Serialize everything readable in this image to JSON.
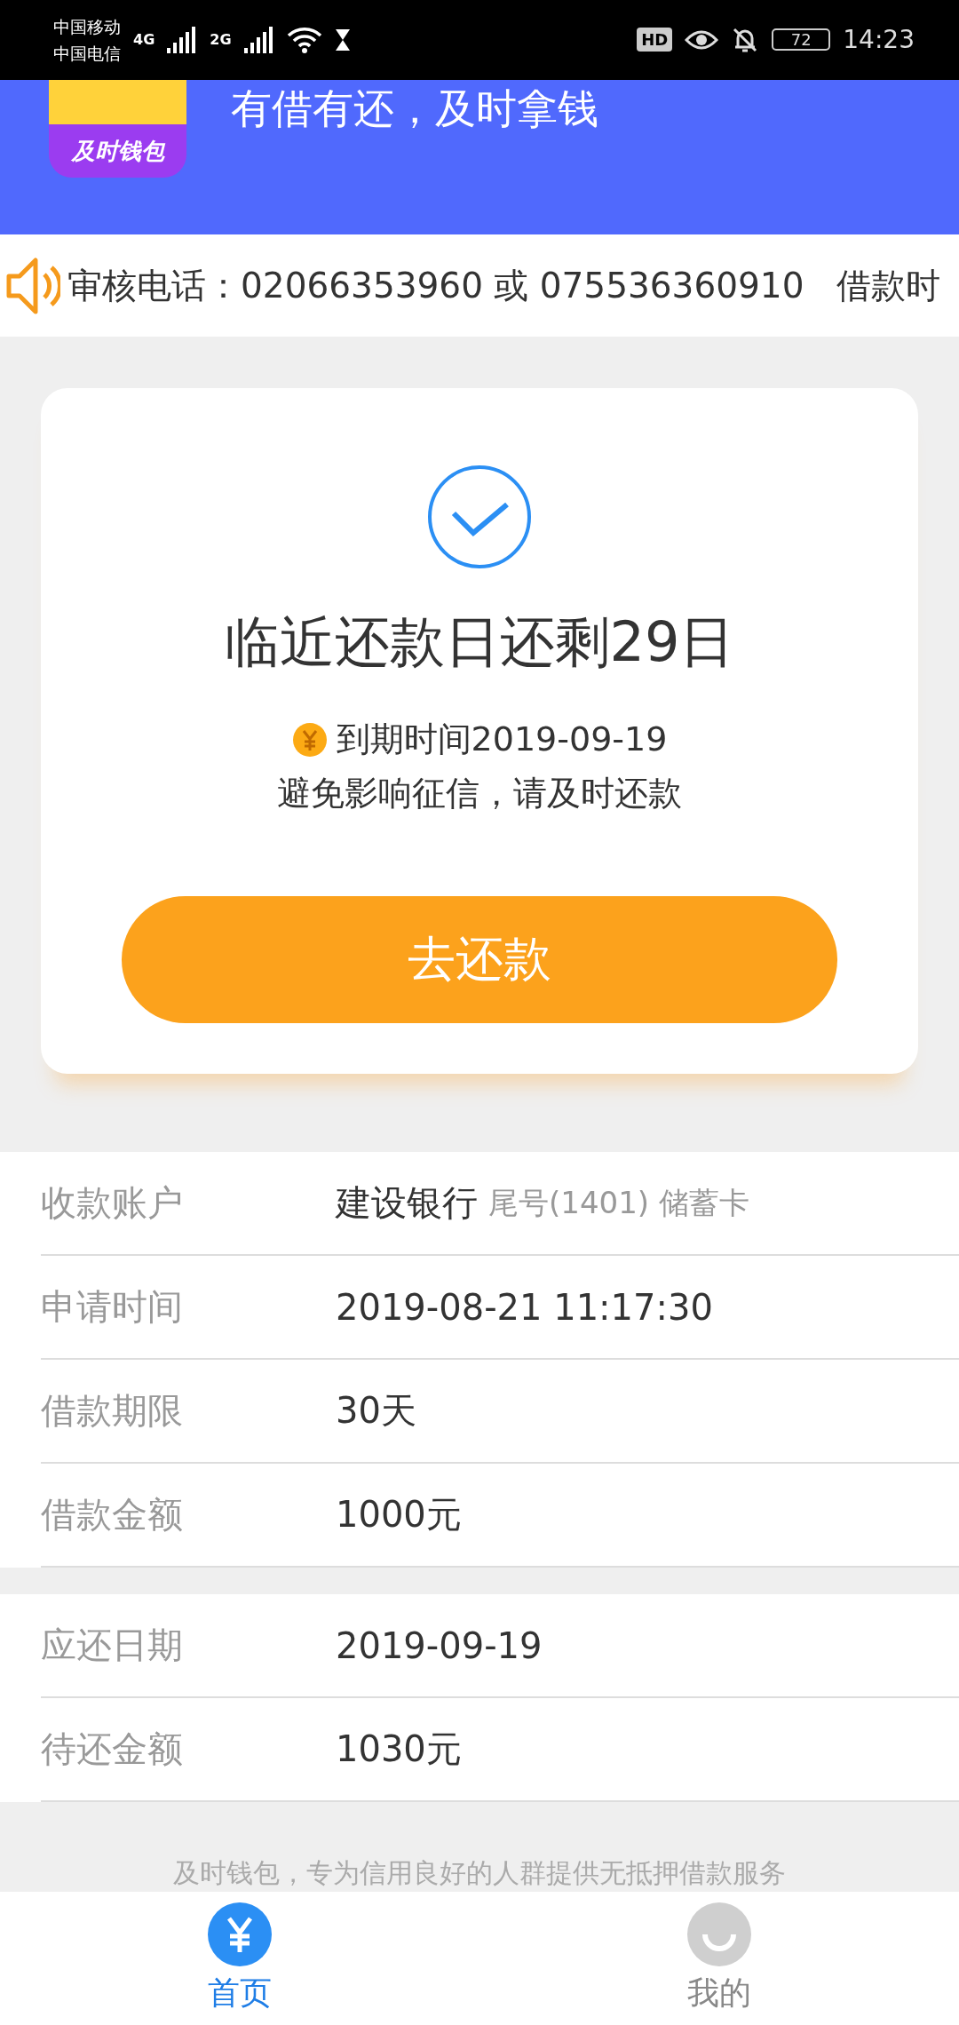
{
  "status_bar": {
    "carriers": [
      "中国移动",
      "中国电信"
    ],
    "networks": [
      "4G",
      "2G"
    ],
    "hd": "HD",
    "battery": "72",
    "time": "14:23"
  },
  "header": {
    "logo_text": "及时钱包",
    "slogan": "有借有还，及时拿钱"
  },
  "notice": {
    "items": [
      "审核电话：02066353960 或 075536360910",
      "借款时"
    ]
  },
  "repay_card": {
    "title": "临近还款日还剩29日",
    "due": "到期时间2019-09-19",
    "hint": "避免影响征信，请及时还款",
    "button": "去还款"
  },
  "loan_details": [
    {
      "label": "收款账户",
      "value": "建设银行",
      "note": "尾号(1401) 储蓄卡"
    },
    {
      "label": "申请时间",
      "value": "2019-08-21 11:17:30"
    },
    {
      "label": "借款期限",
      "value": "30天"
    },
    {
      "label": "借款金额",
      "value": "1000元"
    }
  ],
  "repay_details": [
    {
      "label": "应还日期",
      "value": "2019-09-19"
    },
    {
      "label": "待还金额",
      "value": "1030元"
    }
  ],
  "footer": "及时钱包，专为信用良好的人群提供无抵押借款服务",
  "tabs": [
    {
      "label": "首页",
      "kind": "yuan",
      "selected": true
    },
    {
      "label": "我的",
      "kind": "smile",
      "selected": false
    }
  ]
}
